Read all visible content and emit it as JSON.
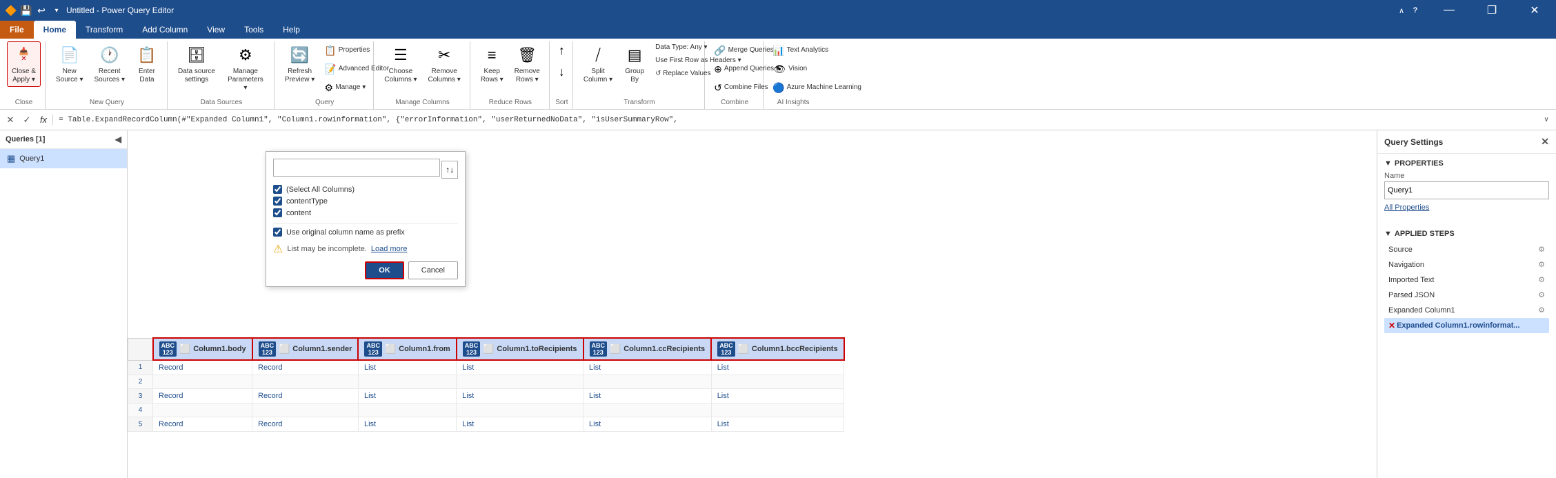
{
  "titleBar": {
    "title": "Untitled - Power Query Editor",
    "icons": [
      "💾",
      "↩"
    ],
    "windowBtns": [
      "—",
      "❐",
      "✕"
    ]
  },
  "ribbonTabs": [
    {
      "id": "file",
      "label": "File",
      "active": false,
      "isFile": true
    },
    {
      "id": "home",
      "label": "Home",
      "active": true
    },
    {
      "id": "transform",
      "label": "Transform"
    },
    {
      "id": "add-column",
      "label": "Add Column"
    },
    {
      "id": "view",
      "label": "View"
    },
    {
      "id": "tools",
      "label": "Tools"
    },
    {
      "id": "help",
      "label": "Help"
    }
  ],
  "ribbon": {
    "groups": {
      "close": {
        "label": "Close",
        "closeApplyLabel": "Close &\nApply",
        "closeApplyIcon": "✕"
      },
      "newQuery": {
        "label": "New Query",
        "buttons": [
          {
            "id": "new-source",
            "label": "New\nSource",
            "icon": "📄"
          },
          {
            "id": "recent-sources",
            "label": "Recent\nSources",
            "icon": "🕐"
          },
          {
            "id": "enter-data",
            "label": "Enter\nData",
            "icon": "📋"
          }
        ]
      },
      "dataSources": {
        "label": "Data Sources",
        "buttons": [
          {
            "id": "data-source-settings",
            "label": "Data source\nsettings",
            "icon": "🗄"
          },
          {
            "id": "manage-parameters",
            "label": "Manage\nParameters",
            "icon": "⚙"
          }
        ]
      },
      "query": {
        "label": "Query",
        "buttons": [
          {
            "id": "refresh-preview",
            "label": "Refresh\nPreview",
            "icon": "🔄"
          },
          {
            "id": "properties",
            "label": "Properties",
            "icon": "📋"
          },
          {
            "id": "advanced-editor",
            "label": "Advanced Editor",
            "icon": "📝"
          },
          {
            "id": "manage",
            "label": "Manage ▾",
            "icon": "⚙"
          }
        ]
      },
      "manageColumns": {
        "label": "Manage Columns",
        "buttons": [
          {
            "id": "choose-columns",
            "label": "Choose\nColumns",
            "icon": "☰"
          },
          {
            "id": "remove-columns",
            "label": "Remove\nColumns",
            "icon": "✂"
          },
          {
            "id": "keep-rows",
            "label": "Keep\nRows",
            "icon": "≡"
          },
          {
            "id": "remove-rows",
            "label": "Remove\nRows",
            "icon": "🗑"
          }
        ]
      },
      "reduceRows": {
        "label": "Reduce Rows",
        "buttons": []
      },
      "sort": {
        "label": "Sort",
        "buttons": [
          {
            "id": "sort-asc",
            "label": "↑",
            "icon": "↑"
          },
          {
            "id": "sort-desc",
            "label": "↓",
            "icon": "↓"
          }
        ]
      },
      "transform": {
        "label": "Transform",
        "buttons": [
          {
            "id": "split-column",
            "label": "Split\nColumn",
            "icon": "⧸"
          },
          {
            "id": "group-by",
            "label": "Group\nBy",
            "icon": "▤"
          },
          {
            "id": "data-type",
            "label": "Data Type: Any ▾",
            "icon": ""
          },
          {
            "id": "use-first-row",
            "label": "Use First Row as Headers ▾",
            "icon": ""
          },
          {
            "id": "replace-values",
            "label": "↺ Replace Values",
            "icon": ""
          }
        ]
      },
      "combine": {
        "label": "Combine",
        "buttons": [
          {
            "id": "merge-queries",
            "label": "Merge Queries ▾",
            "icon": "🔗"
          },
          {
            "id": "append-queries",
            "label": "Append Queries ▾",
            "icon": "⊕"
          },
          {
            "id": "combine-files",
            "label": "↺ Combine Files",
            "icon": ""
          }
        ]
      },
      "aiInsights": {
        "label": "AI Insights",
        "buttons": [
          {
            "id": "text-analytics",
            "label": "Text Analytics",
            "icon": "📊"
          },
          {
            "id": "vision",
            "label": "Vision",
            "icon": "👁"
          },
          {
            "id": "azure-ml",
            "label": "Azure Machine Learning",
            "icon": "🔵"
          }
        ]
      }
    }
  },
  "formulaBar": {
    "cancelLabel": "✕",
    "confirmLabel": "✓",
    "fxLabel": "fx",
    "formula": "= Table.ExpandRecordColumn(#\"Expanded Column1\", \"Column1.rowinformation\", {\"errorInformation\", \"userReturnedNoData\", \"isUserSummaryRow\",",
    "expandLabel": "∨"
  },
  "queriesPanel": {
    "title": "Queries [1]",
    "collapseIcon": "◀",
    "items": [
      {
        "id": "query1",
        "label": "Query1",
        "icon": "▦",
        "selected": true
      }
    ]
  },
  "expandPopup": {
    "searchPlaceholder": "",
    "sortIcon": "↑↓",
    "checkboxes": [
      {
        "id": "select-all",
        "label": "(Select All Columns)",
        "checked": true
      },
      {
        "id": "contentType",
        "label": "contentType",
        "checked": true
      },
      {
        "id": "content",
        "label": "content",
        "checked": true
      }
    ],
    "prefixLabel": "Use original column name as prefix",
    "prefixChecked": true,
    "warningText": "List may be incomplete.",
    "loadMoreLabel": "Load more",
    "okLabel": "OK",
    "cancelLabel": "Cancel"
  },
  "grid": {
    "columns": [
      {
        "id": "body",
        "label": "Column1.body",
        "type": "ABC\n123",
        "selected": true
      },
      {
        "id": "sender",
        "label": "Column1.sender",
        "type": "ABC\n123",
        "selected": true
      },
      {
        "id": "from",
        "label": "Column1.from",
        "type": "ABC\n123",
        "selected": true
      },
      {
        "id": "toRecipients",
        "label": "Column1.toRecipients",
        "type": "ABC\n123",
        "selected": true
      },
      {
        "id": "ccRecipients",
        "label": "Column1.ccRecipients",
        "type": "ABC\n123",
        "selected": true
      },
      {
        "id": "bccRecipients",
        "label": "Column1.bccRecipients",
        "type": "ABC\n123",
        "selected": true
      }
    ],
    "rows": [
      {
        "body": "Record",
        "sender": "Record",
        "from": "List",
        "toRecipients": "List",
        "ccRecipients": "List",
        "bccRecipients": "List"
      },
      {
        "body": "",
        "sender": "",
        "from": "",
        "toRecipients": "",
        "ccRecipients": "",
        "bccRecipients": ""
      },
      {
        "body": "Record",
        "sender": "Record",
        "from": "List",
        "toRecipients": "List",
        "ccRecipients": "List",
        "bccRecipients": "List"
      },
      {
        "body": "",
        "sender": "",
        "from": "",
        "toRecipients": "",
        "ccRecipients": "",
        "bccRecipients": ""
      },
      {
        "body": "Record",
        "sender": "Record",
        "from": "List",
        "toRecipients": "List",
        "ccRecipients": "List",
        "bccRecipients": "List"
      }
    ]
  },
  "querySettings": {
    "title": "Query Settings",
    "closeIcon": "✕",
    "propertiesTitle": "PROPERTIES",
    "nameLabel": "Name",
    "nameValue": "Query1",
    "allPropertiesLabel": "All Properties",
    "appliedStepsTitle": "APPLIED STEPS",
    "steps": [
      {
        "id": "source",
        "label": "Source",
        "hasGear": true,
        "isError": false,
        "isActive": false,
        "isDelete": false
      },
      {
        "id": "navigation",
        "label": "Navigation",
        "hasGear": true,
        "isError": false,
        "isActive": false,
        "isDelete": false
      },
      {
        "id": "imported-text",
        "label": "Imported Text",
        "hasGear": false,
        "isError": false,
        "isActive": false,
        "isDelete": false
      },
      {
        "id": "parsed-json",
        "label": "Parsed JSON",
        "hasGear": false,
        "isError": false,
        "isActive": false,
        "isDelete": false
      },
      {
        "id": "expanded-column1",
        "label": "Expanded Column1",
        "hasGear": true,
        "isError": false,
        "isActive": false,
        "isDelete": false
      },
      {
        "id": "expanded-column1-row",
        "label": "✕ Expanded Column1.rowinformat...",
        "hasGear": false,
        "isError": false,
        "isActive": true,
        "isDelete": true
      }
    ]
  }
}
